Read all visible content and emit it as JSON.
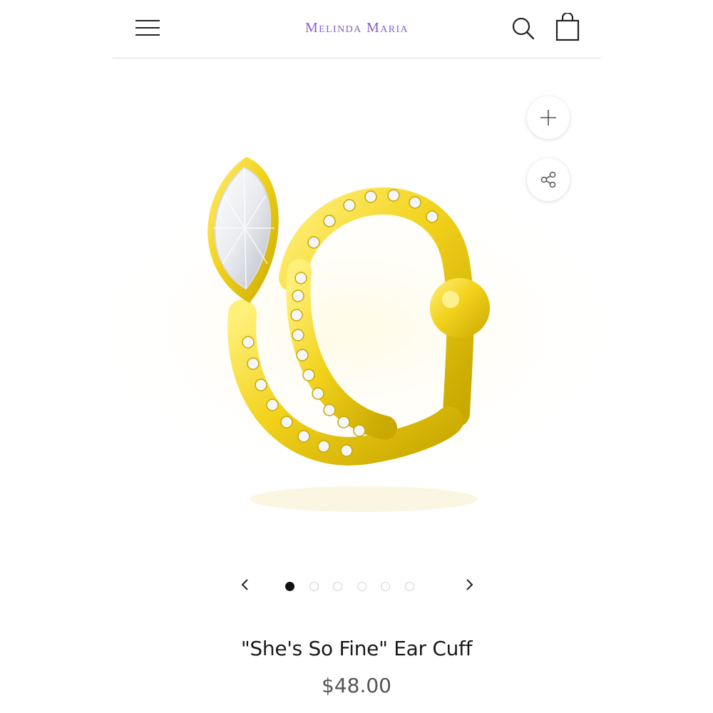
{
  "header": {
    "brand": "Melinda Maria",
    "brand_color": "#8a5fc4",
    "menu_icon": "hamburger-icon",
    "search_icon": "search-icon",
    "cart_icon": "shopping-bag-icon"
  },
  "product_actions": {
    "zoom_icon": "plus-icon",
    "share_icon": "share-icon"
  },
  "carousel": {
    "prev_icon": "chevron-left-icon",
    "next_icon": "chevron-right-icon",
    "slide_count": 6,
    "active_index": 0
  },
  "product": {
    "title": "\"She's So Fine\" Ear Cuff",
    "price": "$48.00",
    "image_subject": "gold ear cuff with marquise crystal and pavé stones"
  },
  "colors": {
    "gold": "#f2d21b",
    "active_dot": "#111111",
    "divider": "#dcdcdc"
  }
}
